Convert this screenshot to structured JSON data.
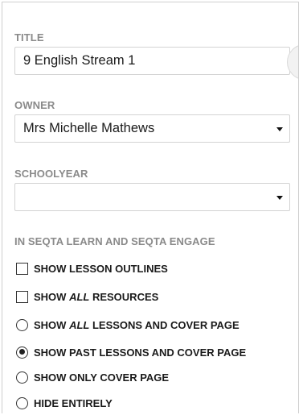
{
  "form": {
    "title": {
      "label": "TITLE",
      "value": "9 English Stream 1"
    },
    "owner": {
      "label": "OWNER",
      "value": "Mrs Michelle Mathews"
    },
    "schoolyear": {
      "label": "SCHOOLYEAR",
      "value": ""
    },
    "visibility": {
      "label": "IN SEQTA LEARN AND SEQTA ENGAGE",
      "checkboxes": [
        {
          "text": "SHOW LESSON OUTLINES",
          "checked": false
        },
        {
          "pre": "SHOW ",
          "em": "ALL",
          "post": " RESOURCES",
          "checked": false
        }
      ],
      "radios": [
        {
          "pre": "SHOW ",
          "em": "ALL",
          "post": " LESSONS AND COVER PAGE",
          "selected": false
        },
        {
          "text": "SHOW PAST LESSONS AND COVER PAGE",
          "selected": true
        },
        {
          "text": "SHOW ONLY COVER PAGE",
          "selected": false
        },
        {
          "text": "HIDE ENTIRELY",
          "selected": false
        }
      ]
    }
  },
  "icons": {
    "caret": "chevron-down-icon",
    "edge_button": "edge-action-icon"
  }
}
